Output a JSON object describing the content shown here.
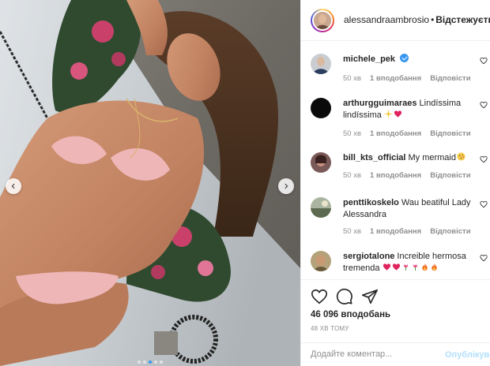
{
  "header": {
    "username": "alessandraambrosio",
    "separator": "•",
    "follow_label": "Відстежується"
  },
  "comments": [
    {
      "username": "michele_pek",
      "text": "",
      "verified": true,
      "time": "50 хв",
      "likes": "1 вподобання",
      "reply": "Відповісти"
    },
    {
      "username": "arthurgguimaraes",
      "text": "Lindíssima lindíssima",
      "emojis": [
        "sparkles",
        "heart"
      ],
      "time": "50 хв",
      "likes": "1 вподобання",
      "reply": "Відповісти"
    },
    {
      "username": "bill_kts_official",
      "text": "My mermaid",
      "emojis": [
        "kiss-face"
      ],
      "time": "50 хв",
      "likes": "1 вподобання",
      "reply": "Відповісти"
    },
    {
      "username": "penttikoskelo",
      "text": "Wau beatiful Lady Alessandra",
      "time": "50 хв",
      "likes": "1 вподобання",
      "reply": "Відповісти"
    },
    {
      "username": "sergiotalone",
      "text": "Increible hermosa tremenda",
      "emojis": [
        "heart",
        "heart",
        "tulip",
        "tulip",
        "fire",
        "fire"
      ]
    }
  ],
  "actions": {
    "like_icon": "heart-outline-icon",
    "comment_icon": "comment-bubble-icon",
    "share_icon": "paper-plane-icon"
  },
  "likes_count": "46 096 вподобань",
  "timestamp": "48 ХВ ТОМУ",
  "comment_form": {
    "placeholder": "Додайте коментар...",
    "post_label": "Опублікувати"
  },
  "carousel": {
    "total": 5,
    "active": 0
  },
  "colors": {
    "accent": "#3897f0",
    "text": "#262626",
    "muted": "#8e8e8e",
    "post_disabled": "#b2dffc"
  }
}
